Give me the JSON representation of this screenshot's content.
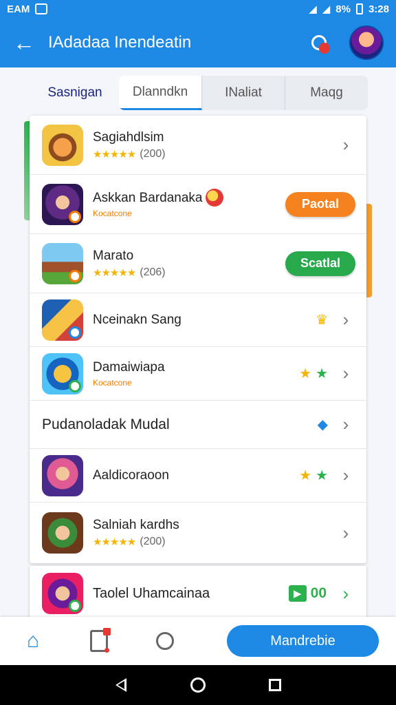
{
  "status_bar": {
    "carrier": "EAM",
    "battery": "8%",
    "time": "3:28"
  },
  "app_bar": {
    "back_icon": "arrow-left-icon",
    "title": "IAdadaa Inendeatin"
  },
  "tabs": [
    {
      "label": "Sasnigan",
      "active": false
    },
    {
      "label": "Dlanndkn",
      "active": true
    },
    {
      "label": "INaliat",
      "active": false
    },
    {
      "label": "Maqg",
      "active": false
    }
  ],
  "list": [
    {
      "name": "Sagiahdlsim",
      "stars": "★★★★★",
      "count": "(200)",
      "action": "chevron"
    },
    {
      "name": "Askkan Bardanaka",
      "subtext": "Kocatcone",
      "action": "pill",
      "pill_label": "Paotal",
      "pill_color": "#f5821f"
    },
    {
      "name": "Marato",
      "stars": "★★★★★",
      "count": "(206)",
      "action": "pill",
      "pill_label": "Scatlal",
      "pill_color": "#27a94c"
    },
    {
      "name": "Nceinakn Sang",
      "mini": "crown",
      "action": "chevron"
    },
    {
      "name": "Damaiwiapa",
      "subtext": "Kocatcone",
      "mini": "stars",
      "action": "chevron"
    },
    {
      "name": "Pudanoladak Mudal",
      "mini": "diamond",
      "action": "chevron"
    },
    {
      "name": "Aaldicoraoon",
      "mini": "stars",
      "action": "chevron"
    },
    {
      "name": "Salniah kardhs",
      "stars": "★★★★★",
      "count": "(200)",
      "action": "chevron"
    }
  ],
  "peek_item": {
    "name": "Taolel Uhamcainaa",
    "badge_text": "00"
  },
  "bottom_nav": {
    "cta_label": "Mandrebie"
  },
  "glyphs": {
    "chevron": "›",
    "star": "★",
    "crown": "♛",
    "diamond": "◆",
    "play": "▶",
    "home": "⌂",
    "back_arrow": "←"
  }
}
